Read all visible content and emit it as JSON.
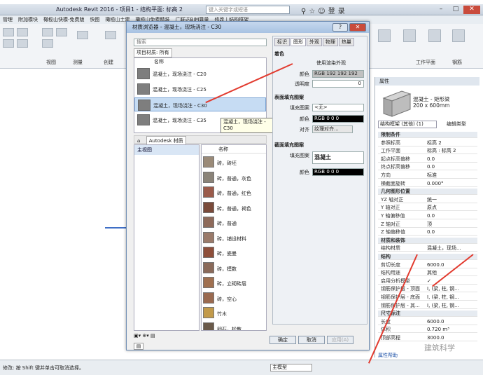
{
  "app": {
    "title": "Autodesk Revit 2016 - 项目1 - 结构平面: 标高 2",
    "search_placeholder": "键入关键字或短语",
    "user_label": "登录"
  },
  "menubar": [
    "管理",
    "附加模块",
    "橄榄山快模-免费版",
    "快图",
    "橄榄山土建",
    "橄榄山免费精装",
    "广联达BIM算量",
    "修改 | 结构框架"
  ],
  "ribbon": {
    "labels": [
      "视图",
      "测量",
      "创建",
      "工作平面",
      "钢筋"
    ]
  },
  "dialog": {
    "title": "材质浏览器 - 混凝土，现场浇注 - C30",
    "search_placeholder": "搜索",
    "project_label": "项目材质: 所有",
    "list_header": "名称",
    "project_materials": [
      "混凝土，现场浇注 - C20",
      "混凝土，现场浇注 - C25",
      "混凝土，现场浇注 - C30",
      "混凝土，现场浇注 - C35"
    ],
    "tooltip": "混凝土，现场浇注 - C30",
    "library_label": "Autodesk 材质",
    "tree_root": "主视图",
    "library_header": "名称",
    "library_items": [
      "砖，砖坯",
      "砖，普通，灰色",
      "砖，普通，红色",
      "砖，普通，褐色",
      "砖，普通",
      "砖，铺设材料",
      "砖，瓷曼",
      "砖，模数",
      "砖，立砌砖层",
      "砖，空心",
      "竹木",
      "卵石，松散"
    ],
    "library_colors": [
      "#9a8a78",
      "#8a8378",
      "#9a5a4a",
      "#7a4a3a",
      "#8e6a5a",
      "#9a7a6a",
      "#8e4e3a",
      "#8a6a5a",
      "#a07050",
      "#9a6a50",
      "#c29a4a",
      "#6a5a4a"
    ],
    "tabs": [
      "标识",
      "图形",
      "外观",
      "物理",
      "热量"
    ],
    "shading": {
      "section": "着色",
      "use_render": "使用渲染外观",
      "color_label": "颜色",
      "color_value": "RGB 192 192 192",
      "transparency_label": "透明度",
      "transparency_value": "0"
    },
    "surface": {
      "section": "表面填充图案",
      "pattern_label": "填充图案",
      "pattern_value": "<无>",
      "color_label": "颜色",
      "color_value": "RGB 0 0 0",
      "align_label": "对齐",
      "align_value": "纹理对齐..."
    },
    "cut": {
      "section": "截面填充图案",
      "pattern_label": "填充图案",
      "pattern_value": "混凝土",
      "color_label": "颜色",
      "color_value": "RGB 0 0 0"
    },
    "ok": "确定",
    "cancel": "取消",
    "apply": "应用(A)"
  },
  "props": {
    "title": "属性",
    "type_name": "混凝土 - 矩形梁",
    "type_size": "200 x 600mm",
    "selector": "结构框架 (其他) (1)",
    "edit_type": "编辑类型",
    "rows": [
      {
        "k": "限制条件",
        "v": "",
        "g": true
      },
      {
        "k": "参照标高",
        "v": "标高 2"
      },
      {
        "k": "工作平面",
        "v": "标高 : 标高 2"
      },
      {
        "k": "起点标高偏移",
        "v": "0.0"
      },
      {
        "k": "终点标高偏移",
        "v": "0.0"
      },
      {
        "k": "方向",
        "v": "标准"
      },
      {
        "k": "横截面旋转",
        "v": "0.000°"
      },
      {
        "k": "几何图形位置",
        "v": "",
        "g": true
      },
      {
        "k": "YZ 轴对正",
        "v": "统一"
      },
      {
        "k": "Y 轴对正",
        "v": "原点"
      },
      {
        "k": "Y 轴偏移值",
        "v": "0.0"
      },
      {
        "k": "Z 轴对正",
        "v": "顶"
      },
      {
        "k": "Z 轴偏移值",
        "v": "0.0"
      },
      {
        "k": "材质和装饰",
        "v": "",
        "g": true
      },
      {
        "k": "结构材质",
        "v": "混凝土，现场..."
      },
      {
        "k": "结构",
        "v": "",
        "g": true
      },
      {
        "k": "剪切长度",
        "v": "6000.0"
      },
      {
        "k": "结构用途",
        "v": "其他"
      },
      {
        "k": "启用分析模型",
        "v": "✓"
      },
      {
        "k": "钢筋保护层 - 顶面",
        "v": "I, (梁, 柱, 钢..."
      },
      {
        "k": "钢筋保护层 - 底面",
        "v": "I, (梁, 柱, 钢..."
      },
      {
        "k": "钢筋保护层 - 其...",
        "v": "I, (梁, 柱, 钢..."
      },
      {
        "k": "尺寸标注",
        "v": "",
        "g": true
      },
      {
        "k": "长度",
        "v": "6000.0"
      },
      {
        "k": "体积",
        "v": "0.720 m³"
      },
      {
        "k": "顶部高程",
        "v": "3000.0"
      }
    ],
    "help_link": "属性帮助"
  },
  "status": {
    "text": "修改: 按 Shift 键并单击可取消选择。",
    "model_label": "主模型"
  },
  "watermark": "建筑科学"
}
